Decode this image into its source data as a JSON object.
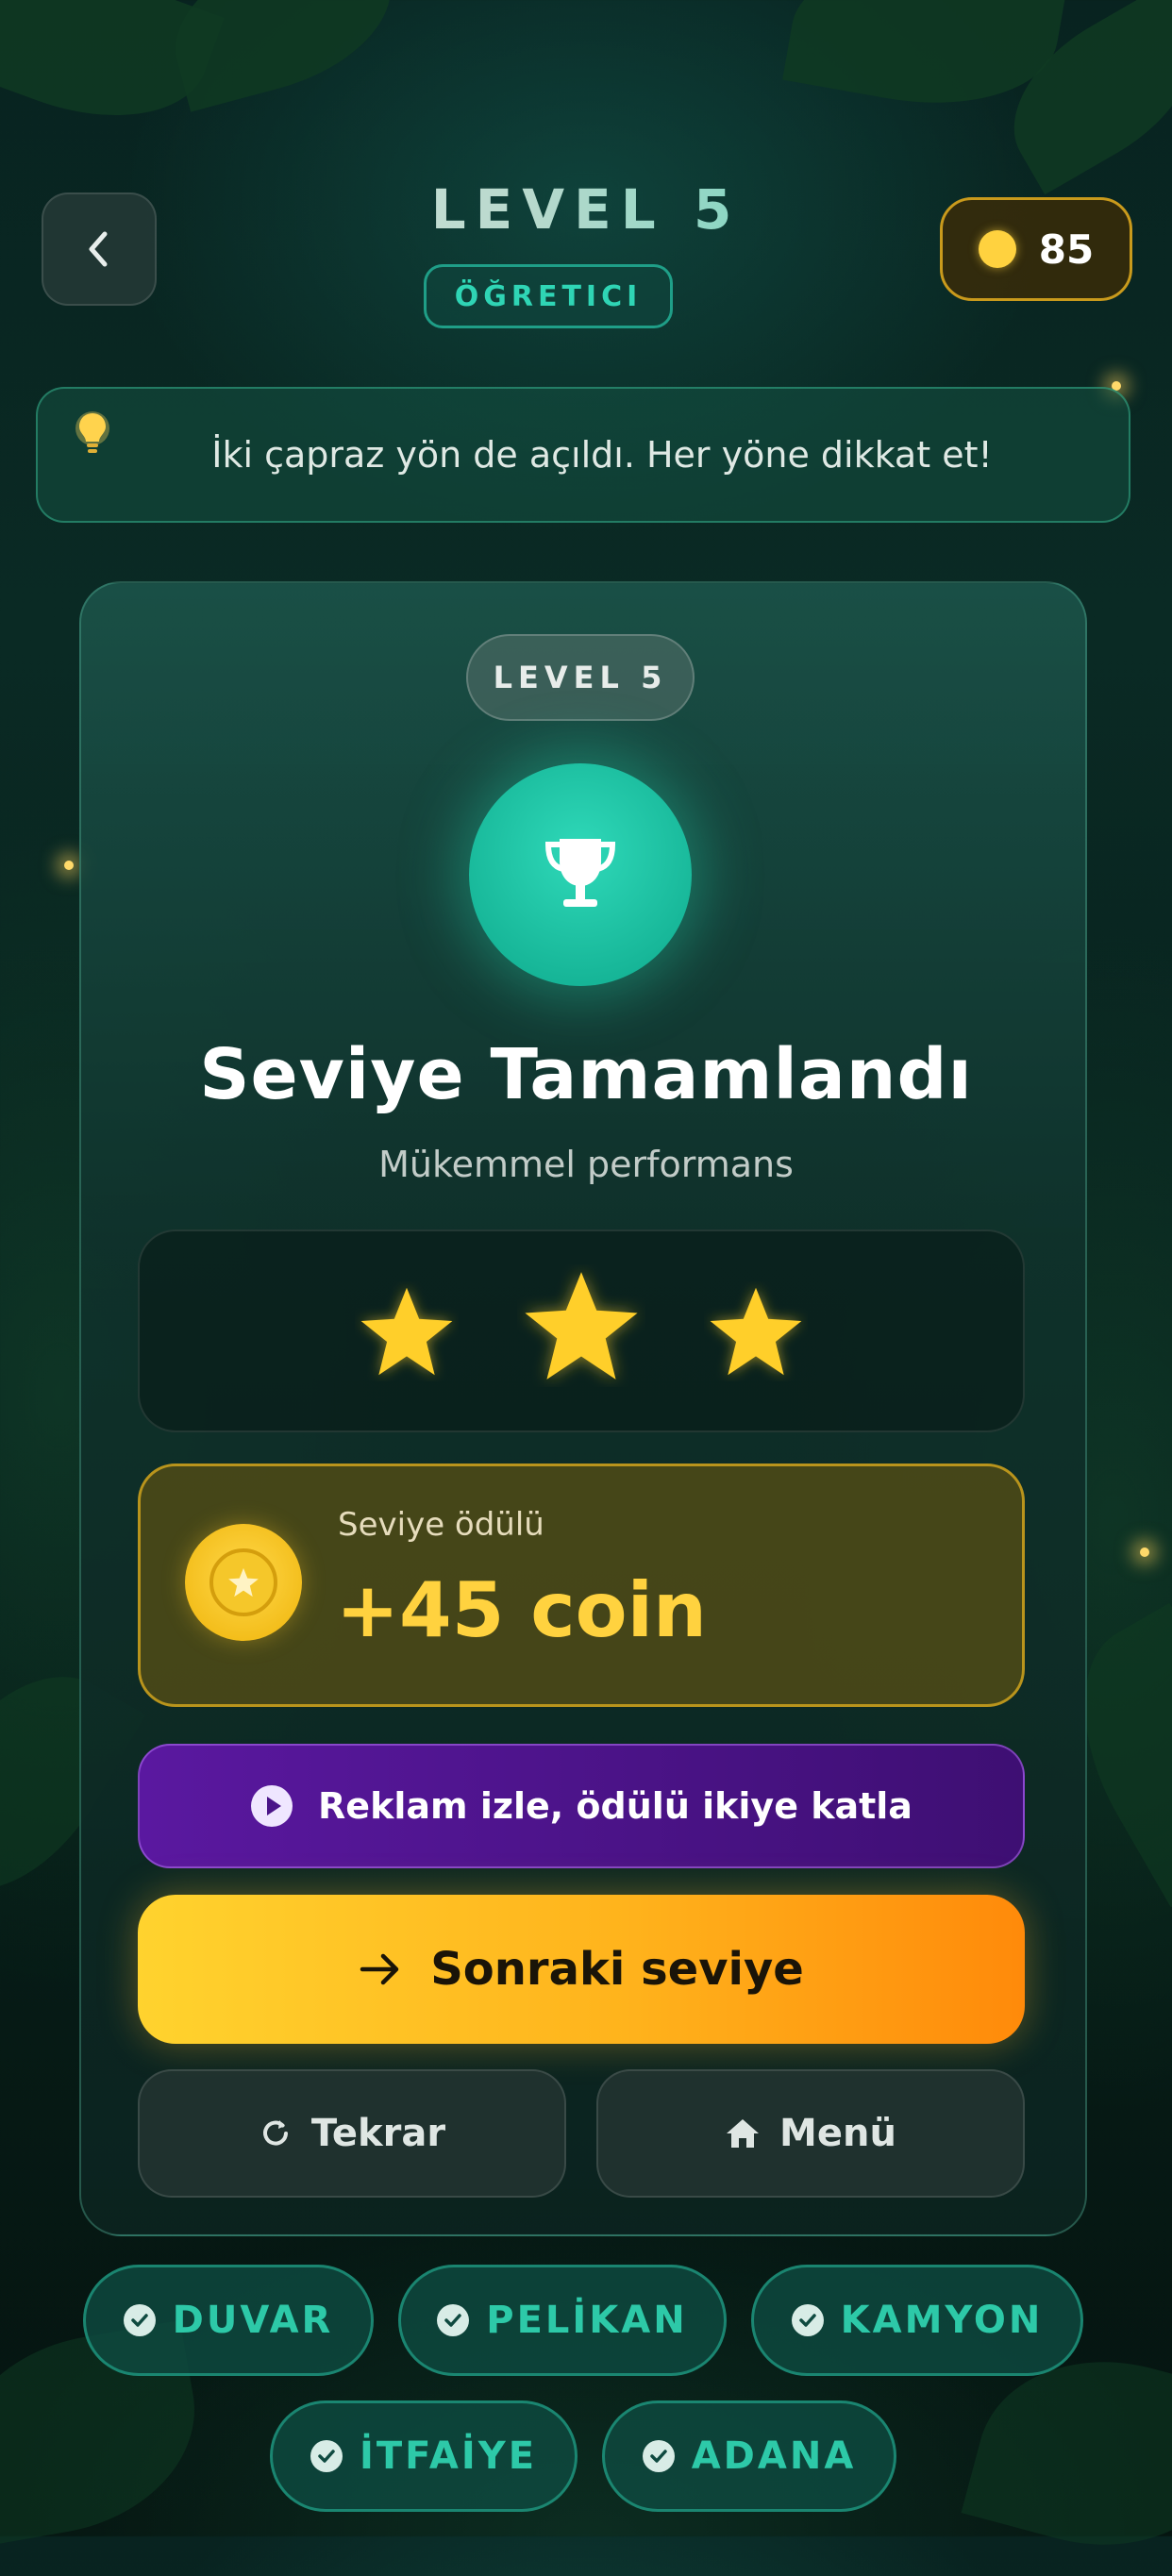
{
  "header": {
    "level_title": "LEVEL 5",
    "difficulty": "ÖĞRETICI",
    "coins": "85",
    "icons": {
      "back": "chevron-left-icon",
      "coin": "coin-icon"
    }
  },
  "hint": {
    "text": "İki çapraz yön de açıldı. Her yöne dikkat et!",
    "icon": "lightbulb-icon"
  },
  "result_card": {
    "level_pill": "LEVEL 5",
    "trophy_icon": "trophy-icon",
    "title": "Seviye Tamamlandı",
    "subtitle": "Mükemmel performans",
    "stars_earned": 3,
    "stars_total": 3,
    "reward": {
      "label": "Seviye ödülü",
      "amount": "+45 coin"
    },
    "buttons": {
      "watch_ad": "Reklam izle, ödülü ikiye katla",
      "next": "Sonraki seviye",
      "retry": "Tekrar",
      "menu": "Menü"
    }
  },
  "found_words": [
    "DUVAR",
    "PELİKAN",
    "KAMYON",
    "İTFAİYE",
    "ADANA"
  ],
  "colors": {
    "accent_teal": "#2fd5b5",
    "gold": "#ffd23f",
    "purple": "#5a18a0",
    "orange": "#ff8a0a"
  }
}
